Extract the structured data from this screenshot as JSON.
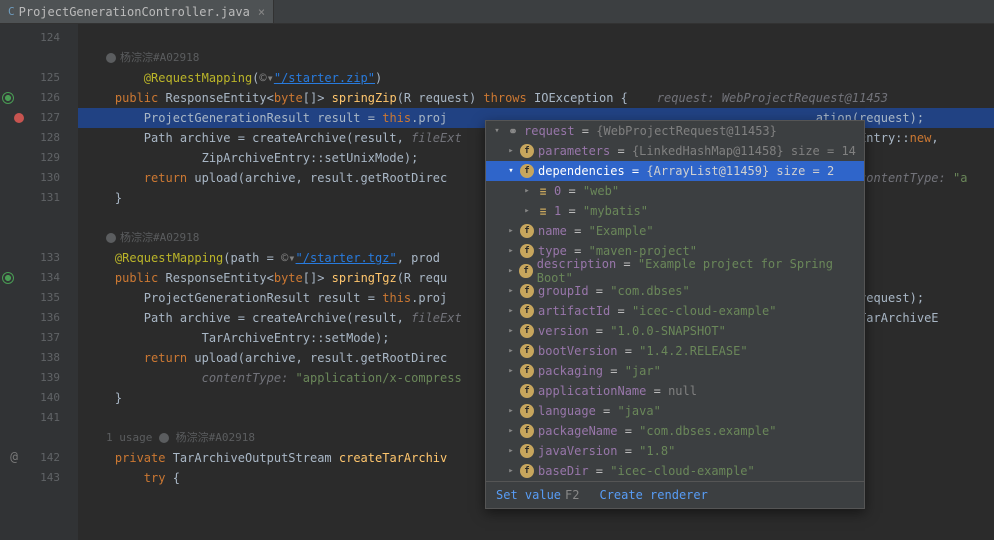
{
  "tab": {
    "title": "ProjectGenerationController.java",
    "icon": "C"
  },
  "lines": [
    {
      "num": "124",
      "type": "code",
      "text": ""
    },
    {
      "num": "",
      "type": "author",
      "author": "杨淙淙#A02918"
    },
    {
      "num": "125",
      "type": "code",
      "html": "        <span class='anno'>@RequestMapping</span>(<span class='comment'>©▾</span><span class='str link'>\"/starter.zip\"</span>)"
    },
    {
      "num": "126",
      "type": "code",
      "gutterIcon": "green",
      "html": "    <span class='kw'>public</span> ResponseEntity&lt;<span class='kw'>byte</span>[]&gt; <span class='method'>springZip</span>(R request) <span class='kw'>throws</span> IOException {    <span class='param'>request: WebProjectRequest@11453</span>"
    },
    {
      "num": "127",
      "type": "code",
      "gutterIcon": "red",
      "selected": true,
      "html": "        ProjectGenerationResult result = <span class='kw'>this</span>.proj                                                   ation(request);"
    },
    {
      "num": "128",
      "type": "code",
      "html": "        Path archive = createArchive(result, <span class='param'>fileExt</span>                                                   hiveEntry::<span class='kw'>new</span>,"
    },
    {
      "num": "129",
      "type": "code",
      "html": "                ZipArchiveEntry::setUnixMode);"
    },
    {
      "num": "130",
      "type": "code",
      "html": "        <span class='kw'>return</span> upload(archive, result.getRootDirec                                                   )),   <span class='param'>contentType:</span> <span class='str'>\"a</span>"
    },
    {
      "num": "131",
      "type": "code",
      "html": "    }"
    },
    {
      "num": "",
      "type": "blank"
    },
    {
      "num": "",
      "type": "author",
      "author": "杨淙淙#A02918"
    },
    {
      "num": "133",
      "type": "code",
      "html": "    <span class='anno'>@RequestMapping</span>(path = <span class='comment'>©▾</span><span class='str link'>\"/starter.tgz\"</span>, prod"
    },
    {
      "num": "134",
      "type": "code",
      "gutterIcon": "green",
      "html": "    <span class='kw'>public</span> ResponseEntity&lt;<span class='kw'>byte</span>[]&gt; <span class='method'>springTgz</span>(R requ"
    },
    {
      "num": "135",
      "type": "code",
      "html": "        ProjectGenerationResult result = <span class='kw'>this</span>.proj                                                   ation(request);"
    },
    {
      "num": "136",
      "type": "code",
      "html": "        Path archive = createArchive(result, <span class='param'>fileExt</span>                                                   am, TarArchiveE"
    },
    {
      "num": "137",
      "type": "code",
      "html": "                TarArchiveEntry::setMode);"
    },
    {
      "num": "138",
      "type": "code",
      "html": "        <span class='kw'>return</span> upload(archive, result.getRootDirec                                                   gz<span class='str'>\"</span>),"
    },
    {
      "num": "139",
      "type": "code",
      "html": "                <span class='param'>contentType:</span> <span class='str'>\"application/x-compress</span>"
    },
    {
      "num": "140",
      "type": "code",
      "html": "    }"
    },
    {
      "num": "141",
      "type": "code",
      "html": ""
    },
    {
      "num": "",
      "type": "usage",
      "text": "1 usage   ",
      "author": "杨淙淙#A02918"
    },
    {
      "num": "142",
      "type": "code",
      "gutterIcon": "at",
      "html": "    <span class='kw'>private</span> TarArchiveOutputStream <span class='method'>createTarArchiv</span>"
    },
    {
      "num": "143",
      "type": "code",
      "html": "        <span class='kw'>try</span> {"
    }
  ],
  "debug": {
    "root": {
      "name": "request",
      "val": "{WebProjectRequest@11453}"
    },
    "parameters": {
      "name": "parameters",
      "val": "{LinkedHashMap@11458}  size = 14"
    },
    "dependencies": {
      "name": "dependencies",
      "val": "{ArrayList@11459}  size = 2"
    },
    "dep0": {
      "idx": "0",
      "val": "\"web\""
    },
    "dep1": {
      "idx": "1",
      "val": "\"mybatis\""
    },
    "fields": [
      {
        "name": "name",
        "val": "\"Example\""
      },
      {
        "name": "type",
        "val": "\"maven-project\""
      },
      {
        "name": "description",
        "val": "\"Example project for Spring Boot\""
      },
      {
        "name": "groupId",
        "val": "\"com.dbses\""
      },
      {
        "name": "artifactId",
        "val": "\"icec-cloud-example\""
      },
      {
        "name": "version",
        "val": "\"1.0.0-SNAPSHOT\""
      },
      {
        "name": "bootVersion",
        "val": "\"1.4.2.RELEASE\""
      },
      {
        "name": "packaging",
        "val": "\"jar\""
      },
      {
        "name": "applicationName",
        "val": "null",
        "isNull": true
      },
      {
        "name": "language",
        "val": "\"java\""
      },
      {
        "name": "packageName",
        "val": "\"com.dbses.example\""
      },
      {
        "name": "javaVersion",
        "val": "\"1.8\""
      },
      {
        "name": "baseDir",
        "val": "\"icec-cloud-example\""
      }
    ],
    "footer": {
      "setValue": "Set value",
      "setValueKey": "F2",
      "createRenderer": "Create renderer"
    }
  }
}
